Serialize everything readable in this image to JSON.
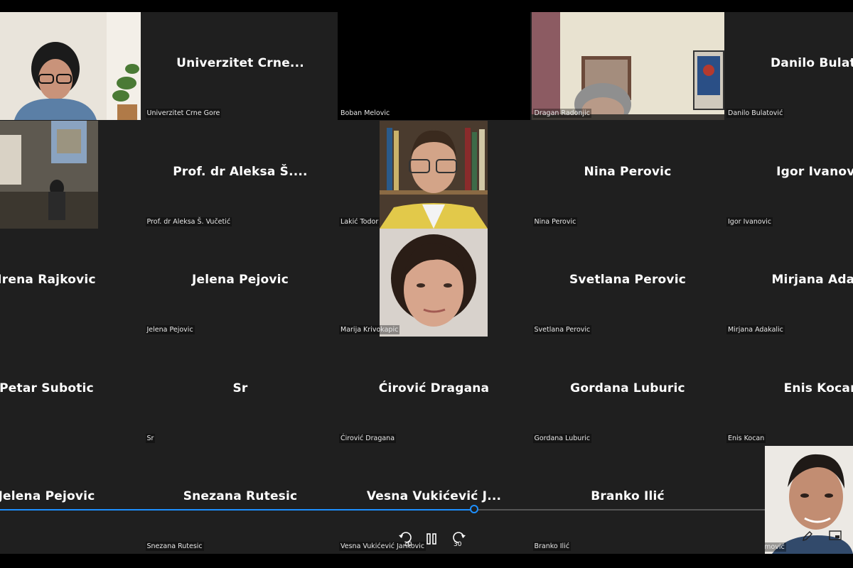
{
  "tiles": [
    {
      "big": "",
      "small": "",
      "video": "woman-glasses"
    },
    {
      "big": "Univerzitet  Crne...",
      "small": "Univerzitet Crne Gore"
    },
    {
      "big": "",
      "small": "Boban Melovic"
    },
    {
      "big": "",
      "small": "Dragan Radonjic",
      "video": "office-man"
    },
    {
      "big": "Danilo Bulatov",
      "small": "Danilo Bulatović"
    },
    {
      "big": "",
      "small": "",
      "video": "classroom"
    },
    {
      "big": "Prof. dr Aleksa Š....",
      "small": "Prof. dr Aleksa Š. Vučetić"
    },
    {
      "big": "",
      "small": "Lakić Todor",
      "video": "young-man"
    },
    {
      "big": "Nina Perovic",
      "small": "Nina Perovic"
    },
    {
      "big": "Igor Ivanovic",
      "small": "Igor Ivanovic"
    },
    {
      "big": "Irena Rajkovic",
      "small": ""
    },
    {
      "big": "Jelena Pejovic",
      "small": "Jelena Pejovic"
    },
    {
      "big": "",
      "small": "Marija Krivokapic",
      "video": "woman-short-hair"
    },
    {
      "big": "Svetlana Perovic",
      "small": "Svetlana Perovic"
    },
    {
      "big": "Mirjana Adaka",
      "small": "Mirjana Adakalic"
    },
    {
      "big": "Petar Subotic",
      "small": ""
    },
    {
      "big": "Sr",
      "small": "Sr"
    },
    {
      "big": "Ćirović Dragana",
      "small": "Ćirović Dragana"
    },
    {
      "big": "Gordana Luburic",
      "small": "Gordana Luburic"
    },
    {
      "big": "Enis Kocan",
      "small": "Enis Kocan"
    },
    {
      "big": "Jelena Pejovic",
      "small": ""
    },
    {
      "big": "Snezana Rutesic",
      "small": "Snezana Rutesic"
    },
    {
      "big": "Vesna Vukićević J...",
      "small": "Vesna Vukićević Jankovic"
    },
    {
      "big": "Branko Ilić",
      "small": "Branko Ilić"
    },
    {
      "big": "",
      "small": "Marijan Premović",
      "video": "pip-man"
    }
  ],
  "player": {
    "progress_fraction": 0.556,
    "rewind_label": "10",
    "forward_label": "30",
    "accent": "#1e90ff"
  },
  "icons": {
    "rewind": "rewind-10-icon",
    "pause": "pause-icon",
    "forward": "forward-30-icon",
    "pencil": "pencil-icon",
    "pip": "picture-in-picture-icon"
  }
}
